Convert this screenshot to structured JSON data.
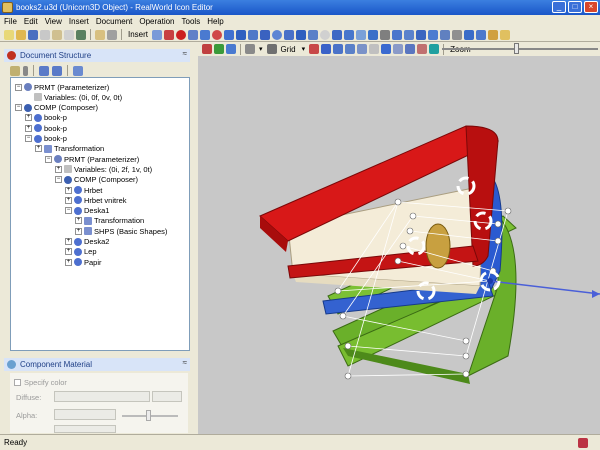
{
  "window": {
    "title": "books2.u3d (Unicorn3D Object) - RealWorld Icon Editor",
    "min": "_",
    "max": "□",
    "close": "×"
  },
  "menu": [
    "File",
    "Edit",
    "View",
    "Insert",
    "Document",
    "Operation",
    "Tools",
    "Help"
  ],
  "toolbar": {
    "insert_label": "Insert"
  },
  "toolbar2": {
    "grid_label": "Grid",
    "zoom_label": "Zoom",
    "zoom_level": 0.48
  },
  "document_panel": {
    "title": "Document Structure"
  },
  "tree": [
    {
      "label": "PRMT (Parameterizer)",
      "icon": "prmt",
      "expander": "−"
    },
    {
      "label": "Variables: (0i, 0f, 0v, 0t)",
      "icon": "var",
      "expander": ""
    },
    {
      "label": "COMP (Composer)",
      "icon": "comp",
      "expander": "−"
    },
    {
      "label": "book-p",
      "icon": "leaf",
      "expander": "+"
    },
    {
      "label": "book-p",
      "icon": "leaf",
      "expander": "+"
    },
    {
      "label": "book-p",
      "icon": "leaf",
      "expander": "−"
    },
    {
      "label": "Transformation",
      "icon": "tr",
      "expander": "+"
    },
    {
      "label": "PRMT (Parameterizer)",
      "icon": "prmt",
      "expander": "−"
    },
    {
      "label": "Variables: (0i, 2f, 1v, 0t)",
      "icon": "var",
      "expander": "+"
    },
    {
      "label": "COMP (Composer)",
      "icon": "comp",
      "expander": "−"
    },
    {
      "label": "Hrbet",
      "icon": "leaf",
      "expander": "+"
    },
    {
      "label": "Hrbet vnitrek",
      "icon": "leaf",
      "expander": "+"
    },
    {
      "label": "Deska1",
      "icon": "leaf",
      "expander": "−"
    },
    {
      "label": "Transformation",
      "icon": "tr",
      "expander": "+"
    },
    {
      "label": "SHPS (Basic Shapes)",
      "icon": "tr",
      "expander": "+"
    },
    {
      "label": "Deska2",
      "icon": "leaf",
      "expander": "+"
    },
    {
      "label": "Lep",
      "icon": "leaf",
      "expander": "+"
    },
    {
      "label": "Papir",
      "icon": "leaf",
      "expander": "+"
    }
  ],
  "material_panel": {
    "title": "Component Material",
    "specify_color": "Specify color",
    "diffuse_label": "Diffuse:",
    "alpha_label": "Alpha:"
  },
  "status": {
    "text": "Ready"
  },
  "colors": {
    "red_cover": "#cc1010",
    "blue_spine": "#2050c8",
    "green_cover": "#6ab02a",
    "axis": "#4a5fd8"
  }
}
